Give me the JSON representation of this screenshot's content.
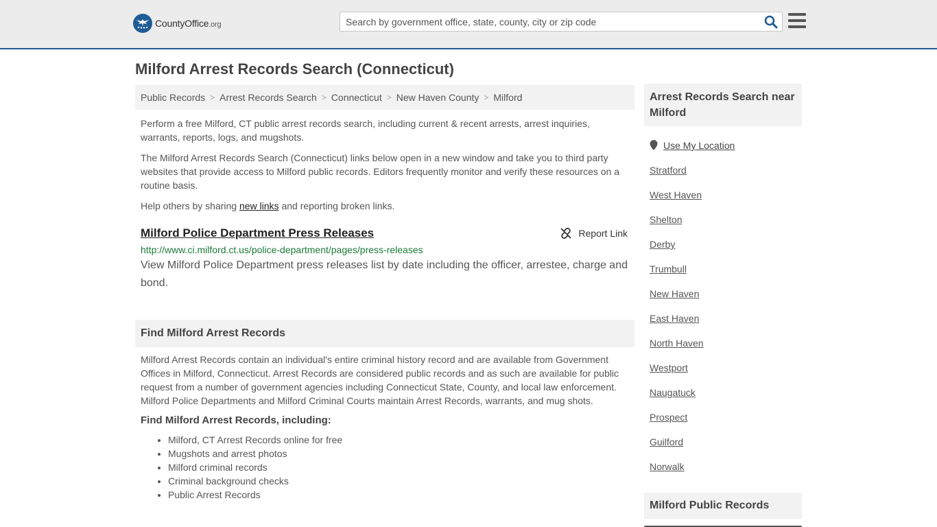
{
  "header": {
    "logo_name": "CountyOffice",
    "logo_tld": ".org",
    "search_placeholder": "Search by government office, state, county, city or zip code",
    "brand_color": "#1f5c96"
  },
  "page": {
    "title": "Milford Arrest Records Search (Connecticut)"
  },
  "breadcrumb": [
    {
      "label": "Public Records"
    },
    {
      "label": "Arrest Records Search"
    },
    {
      "label": "Connecticut"
    },
    {
      "label": "New Haven County"
    },
    {
      "label": "Milford"
    }
  ],
  "intro": {
    "p1": "Perform a free Milford, CT public arrest records search, including current & recent arrests, arrest inquiries, warrants, reports, logs, and mugshots.",
    "p2": "The Milford Arrest Records Search (Connecticut) links below open in a new window and take you to third party websites that provide access to Milford public records. Editors frequently monitor and verify these resources on a routine basis.",
    "p3_before": "Help others by sharing ",
    "p3_link": "new links",
    "p3_after": " and reporting broken links."
  },
  "listing": {
    "title": "Milford Police Department Press Releases",
    "report_label": "Report Link",
    "url": "http://www.ci.milford.ct.us/police-department/pages/press-releases",
    "description": "View Milford Police Department press releases list by date including the officer, arrestee, charge and bond.",
    "url_color": "#1c7a3a"
  },
  "find_section": {
    "heading": "Find Milford Arrest Records",
    "body": "Milford Arrest Records contain an individual's entire criminal history record and are available from Government Offices in Milford, Connecticut. Arrest Records are considered public records and as such are available for public request from a number of government agencies including Connecticut State, County, and local law enforcement. Milford Police Departments and Milford Criminal Courts maintain Arrest Records, warrants, and mug shots.",
    "subheading": "Find Milford Arrest Records, including:",
    "bullets": [
      "Milford, CT Arrest Records online for free",
      "Mugshots and arrest photos",
      "Milford criminal records",
      "Criminal background checks",
      "Public Arrest Records"
    ]
  },
  "sidebar": {
    "heading": "Arrest Records Search near Milford",
    "location_label": "Use My Location",
    "nearby": [
      "Stratford",
      "West Haven",
      "Shelton",
      "Derby",
      "Trumbull",
      "New Haven",
      "East Haven",
      "North Haven",
      "Westport",
      "Naugatuck",
      "Prospect",
      "Guilford",
      "Norwalk"
    ],
    "heading2": "Milford Public Records"
  }
}
